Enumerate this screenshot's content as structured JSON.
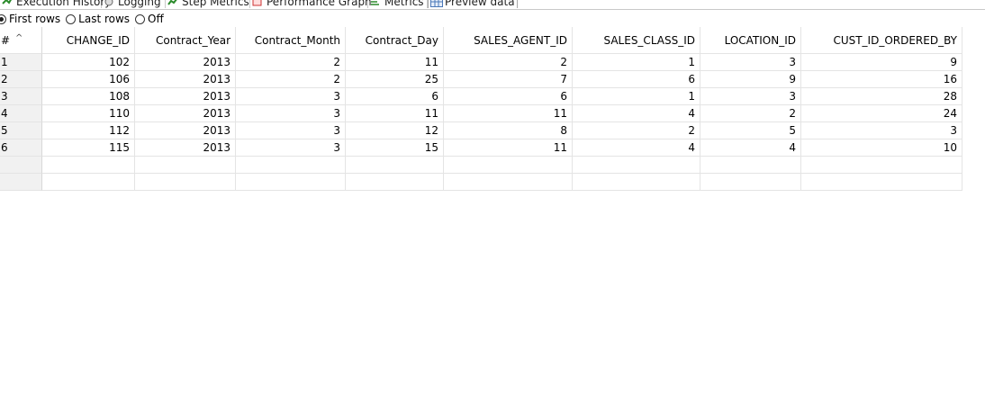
{
  "tabs": [
    {
      "label": "Execution History",
      "icon": "execution-history-icon"
    },
    {
      "label": "Logging",
      "icon": "logging-icon"
    },
    {
      "label": "Step Metrics",
      "icon": "step-metrics-icon"
    },
    {
      "label": "Performance Graph",
      "icon": "performance-graph-icon"
    },
    {
      "label": "Metrics",
      "icon": "metrics-icon"
    },
    {
      "label": "Preview data",
      "icon": "preview-data-icon"
    }
  ],
  "radios": [
    {
      "label": "First rows",
      "selected": true
    },
    {
      "label": "Last rows",
      "selected": false
    },
    {
      "label": "Off",
      "selected": false
    }
  ],
  "table": {
    "rownum_header": "#",
    "columns": [
      "CHANGE_ID",
      "Contract_Year",
      "Contract_Month",
      "Contract_Day",
      "SALES_AGENT_ID",
      "SALES_CLASS_ID",
      "LOCATION_ID",
      "CUST_ID_ORDERED_BY"
    ],
    "rows": [
      [
        "1",
        "102",
        "2013",
        "2",
        "11",
        "2",
        "1",
        "3",
        "9"
      ],
      [
        "2",
        "106",
        "2013",
        "2",
        "25",
        "7",
        "6",
        "9",
        "16"
      ],
      [
        "3",
        "108",
        "2013",
        "3",
        "6",
        "6",
        "1",
        "3",
        "28"
      ],
      [
        "4",
        "110",
        "2013",
        "3",
        "11",
        "11",
        "4",
        "2",
        "24"
      ],
      [
        "5",
        "112",
        "2013",
        "3",
        "12",
        "8",
        "2",
        "5",
        "3"
      ],
      [
        "6",
        "115",
        "2013",
        "3",
        "15",
        "11",
        "4",
        "4",
        "10"
      ],
      [
        "",
        "",
        "",
        "",
        "",
        "",
        "",
        "",
        ""
      ],
      [
        "",
        "",
        "",
        "",
        "",
        "",
        "",
        "",
        ""
      ]
    ]
  }
}
